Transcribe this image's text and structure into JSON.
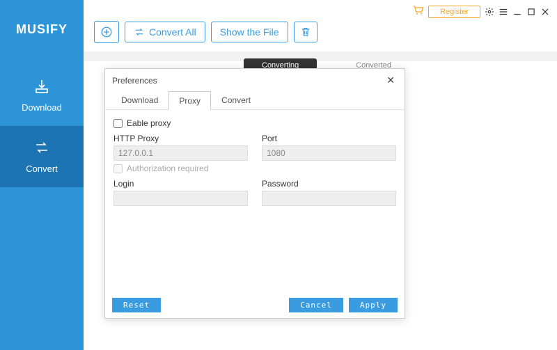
{
  "app": {
    "name": "MUSIFY"
  },
  "sysbar": {
    "register": "Register"
  },
  "sidebar": {
    "items": [
      {
        "label": "Download"
      },
      {
        "label": "Convert"
      }
    ]
  },
  "toolbar": {
    "convert_all": "Convert All",
    "show_file": "Show the File"
  },
  "bg_tabs": {
    "converting": "Converting",
    "converted": "Converted"
  },
  "dialog": {
    "title": "Preferences",
    "tabs": {
      "download": "Download",
      "proxy": "Proxy",
      "convert": "Convert"
    },
    "enable_proxy": "Eable proxy",
    "http_proxy_label": "HTTP Proxy",
    "http_proxy_value": "127.0.0.1",
    "port_label": "Port",
    "port_value": "1080",
    "auth_required": "Authorization required",
    "login_label": "Login",
    "login_value": "",
    "password_label": "Password",
    "password_value": "",
    "reset": "Reset",
    "cancel": "Cancel",
    "apply": "Apply"
  }
}
